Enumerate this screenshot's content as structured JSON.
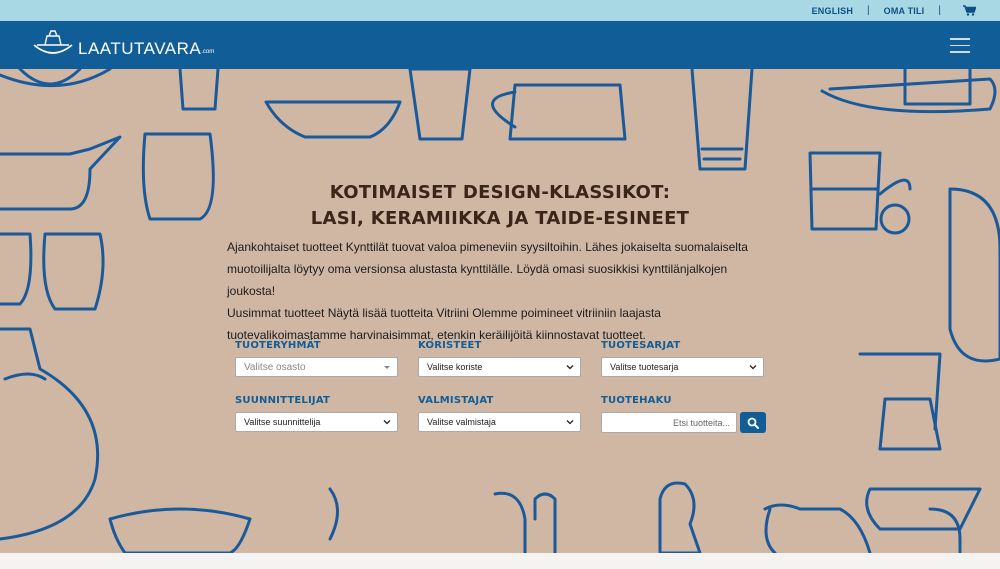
{
  "topbar": {
    "language_link": "ENGLISH",
    "separator": "|",
    "account_link": "OMA TILI",
    "cart_icon": "shopping-cart-icon"
  },
  "brand": {
    "name": "LAATUTAVARA",
    "suffix": ".com",
    "logo_icon": "boat-logo-icon"
  },
  "nav": {
    "menu_icon": "hamburger-menu-icon"
  },
  "colors": {
    "topbar": "#a8d8e3",
    "navbar": "#115d97",
    "hero_bg": "#d0b7a4",
    "outline": "#1a5a9a",
    "label": "#115d97"
  },
  "hero": {
    "headline_line1": "KOTIMAISET DESIGN-KLASSIKOT:",
    "headline_line2": "LASI, KERAMIIKKA JA TAIDE-ESINEET",
    "intro_lines": [
      "Ajankohtaiset tuotteet Kynttilät tuovat valoa pimeneviin syysiltoihin. Lähes jokaiselta suomalaiselta",
      "muotoilijalta löytyy oma versionsa alustasta kynttilälle. Löydä omasi suosikkisi kynttilänjalkojen joukosta!",
      "Uusimmat tuotteet Näytä lisää tuotteita Vitriini Olemme poimineet vitriiniin laajasta",
      "tuotevalikoimastamme harvinaisimmat, etenkin keräilijöitä kiinnostavat tuotteet."
    ]
  },
  "filters": {
    "product_groups": {
      "label": "TUOTERYHMÄT",
      "value": "Valitse osasto"
    },
    "decorations": {
      "label": "KORISTEET",
      "value": "Valitse koriste"
    },
    "series": {
      "label": "TUOTESARJAT",
      "value": "Valitse tuotesarja"
    },
    "designers": {
      "label": "SUUNNITTELIJAT",
      "value": "Valitse suunnittelija"
    },
    "manufacturers": {
      "label": "VALMISTAJAT",
      "value": "Valitse valmistaja"
    },
    "search": {
      "label": "TUOTEHAKU",
      "placeholder": "Etsi tuotteita...",
      "button_icon": "search-icon"
    }
  }
}
